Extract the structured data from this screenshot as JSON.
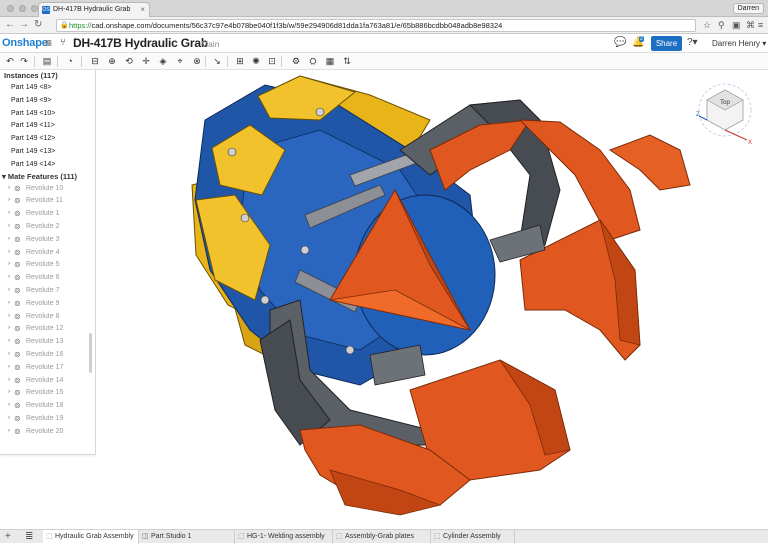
{
  "browser": {
    "tab_title": "DH-417B Hydraulic Grab",
    "tab_favicon": "OS",
    "profile": "Darren",
    "url_scheme": "https://",
    "url_rest": "cad.onshape.com/documents/56c37c97e4b078be040f1f3b/w/59e294906d81dda1fa763a81/e/65b886bcdbb048adb8e98324"
  },
  "header": {
    "logo": "Onshape",
    "title": "DH-417B Hydraulic Grab",
    "workspace": "Main",
    "notifications_count": "2",
    "share_label": "Share",
    "user": "Darren Henry ▾"
  },
  "toolbar": {
    "icons": [
      "undo-icon",
      "redo-icon",
      "clipboard-icon",
      "history-icon",
      "insert-icon",
      "fasten-mate-icon",
      "revolute-mate-icon",
      "slider-mate-icon",
      "planar-mate-icon",
      "cylindrical-mate-icon",
      "pin-slot-mate-icon",
      "ball-mate-icon",
      "mate-connector-icon",
      "group-icon",
      "replicate-icon",
      "gear-relation-icon",
      "rack-pinion-icon",
      "screw-relation-icon",
      "linear-relation-icon"
    ]
  },
  "panel": {
    "instances_header": "Instances (117)",
    "parts": [
      "Part 149 <8>",
      "Part 149 <9>",
      "Part 149 <10>",
      "Part 149 <11>",
      "Part 149 <12>",
      "Part 149 <13>",
      "Part 149 <14>"
    ],
    "mates_header": "Mate Features (111)",
    "mates": [
      "Revolute 10",
      "Revolute 11",
      "Revolute 1",
      "Revolute 2",
      "Revolute 3",
      "Revolute 4",
      "Revolute 5",
      "Revolute 6",
      "Revolute 7",
      "Revolute 9",
      "Revolute 8",
      "Revolute 12",
      "Revolute 13",
      "Revolute 16",
      "Revolute 17",
      "Revolute 14",
      "Revolute 15",
      "Revolute 18",
      "Revolute 19",
      "Revolute 20"
    ]
  },
  "view_cube": {
    "face_label": "Top",
    "axis_x": "X",
    "axis_z": "Z"
  },
  "colors": {
    "accent": "#1d7fd1",
    "gold": "#e9b418",
    "blue": "#1f56a8",
    "orange": "#d9531c",
    "grey": "#5b6067"
  },
  "bottom_tabs": [
    {
      "label": "Hydraulic Grab Assembly",
      "icon": "assembly-icon",
      "active": true
    },
    {
      "label": "Part Studio 1",
      "icon": "part-studio-icon",
      "active": false
    },
    {
      "label": "HG-1- Welding assembly",
      "icon": "assembly-icon",
      "active": false
    },
    {
      "label": "Assembly-Grab plates",
      "icon": "assembly-icon",
      "active": false
    },
    {
      "label": "Cylinder Assembly",
      "icon": "assembly-icon",
      "active": false
    }
  ]
}
